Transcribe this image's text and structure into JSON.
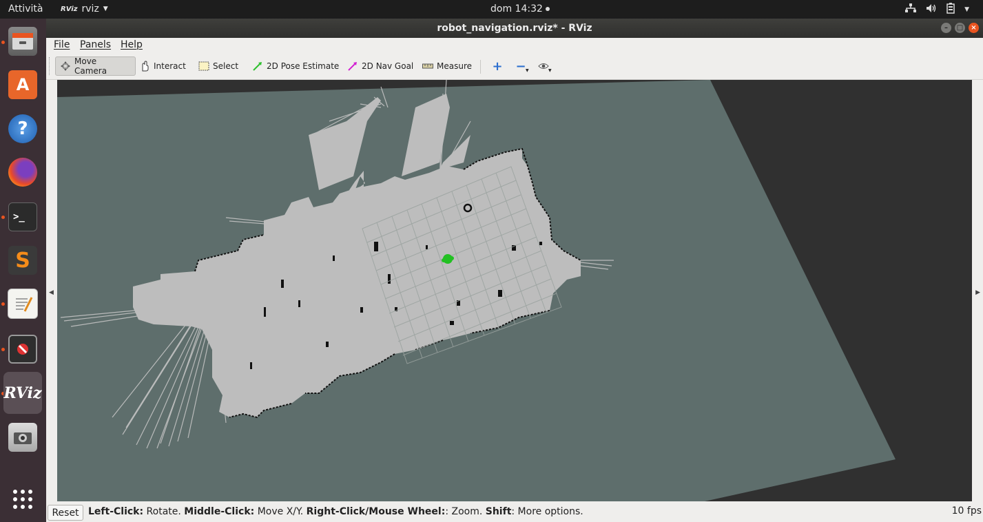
{
  "topbar": {
    "activities": "Attività",
    "app_name": "rviz",
    "app_badge": "RViz",
    "clock": "dom 14:32"
  },
  "dock": {
    "items": [
      {
        "name": "files-icon",
        "running": true
      },
      {
        "name": "software-center-icon",
        "running": false
      },
      {
        "name": "help-icon",
        "running": false
      },
      {
        "name": "firefox-icon",
        "running": false
      },
      {
        "name": "terminal-icon",
        "running": true
      },
      {
        "name": "sublime-text-icon",
        "running": false
      },
      {
        "name": "text-editor-icon",
        "running": true
      },
      {
        "name": "blocked-app-icon",
        "running": true
      },
      {
        "name": "rviz-icon",
        "running": true,
        "label": "RViz"
      },
      {
        "name": "screenshot-icon",
        "running": false
      },
      {
        "name": "show-applications-icon",
        "running": false
      }
    ]
  },
  "window": {
    "title": "robot_navigation.rviz* - RViz"
  },
  "menubar": {
    "file": "File",
    "panels": "Panels",
    "help": "Help"
  },
  "toolbar": {
    "move_camera": "Move Camera",
    "interact": "Interact",
    "select": "Select",
    "pose_estimate": "2D Pose Estimate",
    "nav_goal": "2D Nav Goal",
    "measure": "Measure"
  },
  "viewport": {
    "background_color": "#303030",
    "map_plane_color": "#5e6e6c",
    "free_space_color": "#bebebe",
    "obstacle_color": "#111111",
    "robot_color": "#22c022"
  },
  "statusbar": {
    "reset": "Reset",
    "hint_left_key": "Left-Click:",
    "hint_left_val": " Rotate. ",
    "hint_middle_key": "Middle-Click:",
    "hint_middle_val": " Move X/Y. ",
    "hint_right_key": "Right-Click/Mouse Wheel:",
    "hint_right_val": ": Zoom. ",
    "hint_shift_key": "Shift",
    "hint_shift_val": ": More options.",
    "fps": "10 fps"
  }
}
